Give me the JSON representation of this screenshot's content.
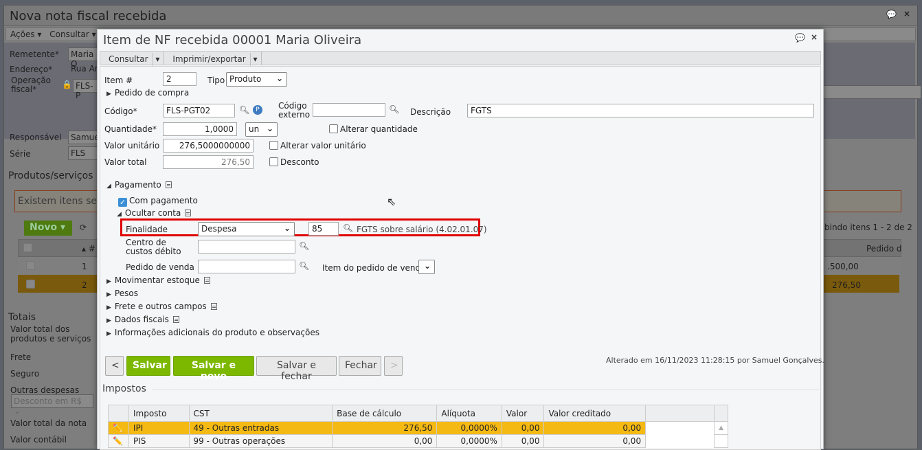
{
  "outer": {
    "title": "Nova nota fiscal recebida",
    "toolbar": [
      "Ações",
      "Consultar"
    ],
    "fields": {
      "remetente_label": "Remetente*",
      "remetente": "Maria O",
      "endereco_label": "Endereço*",
      "endereco": "Rua An",
      "operacao_label": "Operação fiscal*",
      "operacao": "FLS-P",
      "responsavel_label": "Responsável",
      "responsavel": "Samuel",
      "serie_label": "Série",
      "serie": "FLS"
    },
    "produtos_title": "Produtos/serviços",
    "warning": "Existem itens sem",
    "novo": "Novo",
    "paging": "bindo itens 1 - 2 de 2",
    "col_pedido": "Pedido d",
    "rows": [
      {
        "num": "1",
        "valor": ".500,00"
      },
      {
        "num": "2",
        "valor": "276,50"
      }
    ],
    "totais": {
      "title": "Totais",
      "items": [
        "Valor total dos produtos e serviços",
        "Frete",
        "Seguro",
        "Outras despesas",
        "Valor total da nota",
        "Valor contábil"
      ],
      "desconto": "Desconto em R$"
    }
  },
  "modal": {
    "title": "Item de NF recebida 00001 Maria Oliveira",
    "toolbar": [
      "Consultar",
      "Imprimir/exportar"
    ],
    "item_label": "Item #",
    "item": "2",
    "tipo_label": "Tipo",
    "tipo": "Produto",
    "pedido_compra": "Pedido de compra",
    "codigo_label": "Código*",
    "codigo": "FLS-PGT02",
    "codigo_externo_label": "Código externo",
    "codigo_externo": "",
    "descricao_label": "Descrição",
    "descricao": "FGTS",
    "quantidade_label": "Quantidade*",
    "quantidade": "1,0000",
    "unidade": "un",
    "alterar_quantidade": "Alterar quantidade",
    "valor_unitario_label": "Valor unitário",
    "valor_unitario": "276,5000000000",
    "alterar_valor_unitario": "Alterar valor unitário",
    "valor_total_label": "Valor total",
    "valor_total": "276,50",
    "desconto": "Desconto",
    "pagamento": "Pagamento",
    "com_pagamento": "Com pagamento",
    "com_pagamento_checked": true,
    "ocultar_conta": "Ocultar conta",
    "finalidade_label": "Finalidade",
    "finalidade": "Despesa",
    "conta": "85",
    "conta_desc": "FGTS sobre salário (4.02.01.07)",
    "centro_custos_label": "Centro de custos débito",
    "pedido_venda_label": "Pedido de venda",
    "item_pedido_venda_label": "Item do pedido de venda",
    "sections": [
      "Movimentar estoque",
      "Pesos",
      "Frete e outros campos",
      "Dados fiscais",
      "Informações adicionais do produto e observações"
    ],
    "buttons": {
      "prev": "<",
      "salvar": "Salvar",
      "salvar_novo": "Salvar e novo",
      "salvar_fechar": "Salvar e fechar",
      "fechar": "Fechar",
      "next": ">"
    },
    "alterado": "Alterado em 16/11/2023 11:28:15 por Samuel Gonçalves.",
    "impostos": {
      "title": "Impostos",
      "headers": [
        "Imposto",
        "CST",
        "Base de cálculo",
        "Alíquota",
        "Valor",
        "Valor creditado"
      ],
      "rows": [
        [
          "IPI",
          "49 - Outras entradas",
          "276,50",
          "0,0000%",
          "0,00",
          "0,00"
        ],
        [
          "PIS",
          "99 - Outras operações",
          "0,00",
          "0,0000%",
          "0,00",
          "0,00"
        ]
      ]
    }
  },
  "colors": {
    "highlight": "#e00000",
    "green": "#7cb800",
    "selected_row": "#f5b914"
  }
}
